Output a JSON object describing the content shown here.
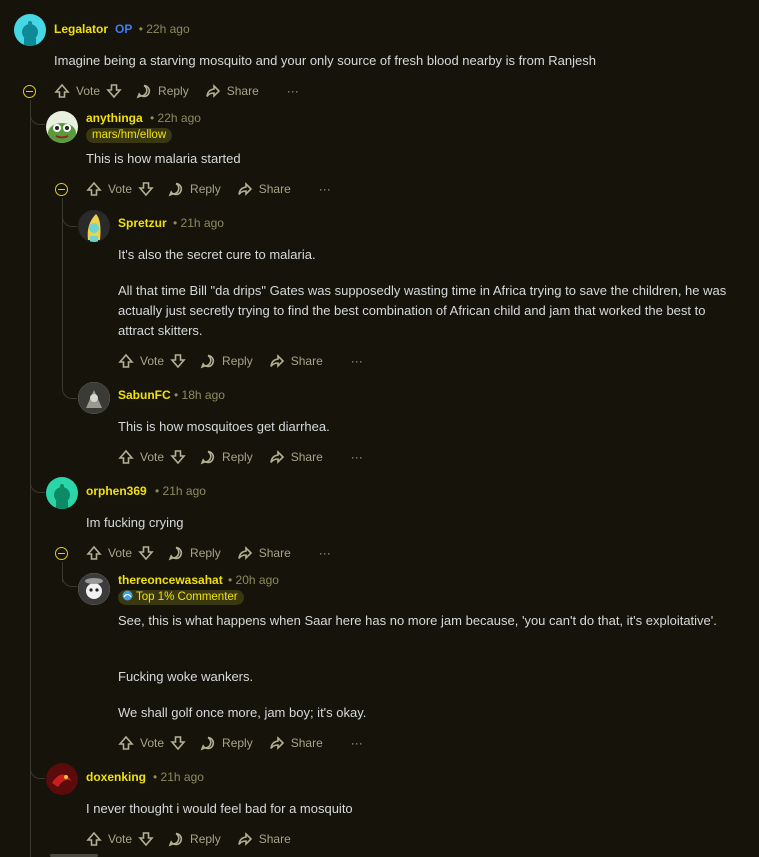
{
  "comments": [
    {
      "username": "Legalator",
      "op_badge": "OP",
      "age": "22h ago",
      "text": "Imagine being a starving mosquito and your only source of fresh blood nearby is from Ranjesh"
    },
    {
      "username": "anythinga",
      "age": "22h ago",
      "flair": "mars/hm/ellow",
      "text": "This is how malaria started"
    },
    {
      "username": "Spretzur",
      "age": "21h ago",
      "paragraphs": [
        "It's also the secret cure to malaria.",
        "All that time Bill \"da drips\" Gates was supposedly wasting time in Africa trying to save the children, he was actually just secretly trying to find the best combination of African child and jam that worked the best to attract skitters."
      ]
    },
    {
      "username": "SabunFC",
      "age": "18h ago",
      "text": "This is how mosquitoes get diarrhea."
    },
    {
      "username": "orphen369",
      "age": "21h ago",
      "text": "Im fucking crying"
    },
    {
      "username": "thereoncewasahat",
      "age": "20h ago",
      "flair": "Top 1% Commenter",
      "paragraphs": [
        "See, this is what happens when Saar here has no more jam because, 'you can't do that, it's exploitative'.",
        "Fucking woke wankers.",
        "We shall golf once more, jam boy; it's okay."
      ]
    },
    {
      "username": "doxenking",
      "age": "21h ago",
      "text": "I never thought i would feel bad for a mosquito"
    }
  ],
  "actions": {
    "vote": "Vote",
    "reply": "Reply",
    "share": "Share",
    "more": "···"
  },
  "meta_separator": "•",
  "colors": {
    "background": "#15130a",
    "username": "#f1e10b",
    "op": "#3f7cf6",
    "meta": "#8f8b5e",
    "thread": "#3a3a2c"
  }
}
